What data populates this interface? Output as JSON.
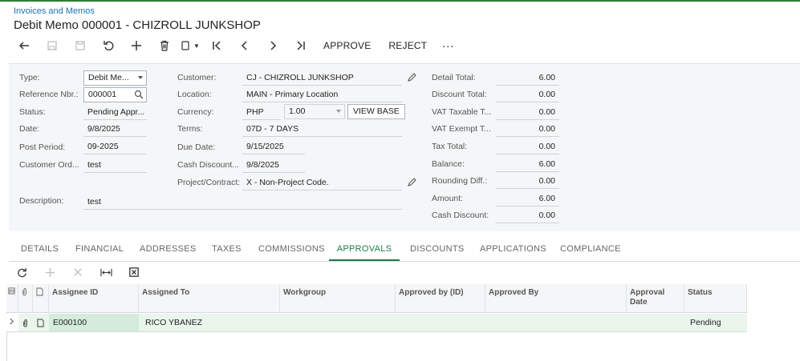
{
  "breadcrumb": "Invoices and Memos",
  "title": "Debit Memo 000001 - CHIZROLL JUNKSHOP",
  "toolbar": {
    "approve": "APPROVE",
    "reject": "REJECT",
    "more": "···"
  },
  "form": {
    "type_label": "Type:",
    "type_value": "Debit Me...",
    "ref_label": "Reference Nbr.:",
    "ref_value": "000001",
    "status_label": "Status:",
    "status_value": "Pending Appr...",
    "date_label": "Date:",
    "date_value": "9/8/2025",
    "period_label": "Post Period:",
    "period_value": "09-2025",
    "custord_label": "Customer Ord...",
    "custord_value": "test",
    "desc_label": "Description:",
    "desc_value": "test",
    "customer_label": "Customer:",
    "customer_value": "CJ - CHIZROLL JUNKSHOP",
    "location_label": "Location:",
    "location_value": "MAIN - Primary Location",
    "currency_label": "Currency:",
    "currency_value": "PHP",
    "rate_value": "1.00",
    "viewbase": "VIEW BASE",
    "terms_label": "Terms:",
    "terms_value": "07D - 7 DAYS",
    "due_label": "Due Date:",
    "due_value": "9/15/2025",
    "cashdisc_label": "Cash Discount...",
    "cashdisc_value": "9/8/2025",
    "project_label": "Project/Contract:",
    "project_value": "X - Non-Project Code."
  },
  "totals": [
    {
      "label": "Detail Total:",
      "value": "6.00"
    },
    {
      "label": "Discount Total:",
      "value": "0.00"
    },
    {
      "label": "VAT Taxable T...",
      "value": "0.00"
    },
    {
      "label": "VAT Exempt T...",
      "value": "0.00"
    },
    {
      "label": "Tax Total:",
      "value": "0.00"
    },
    {
      "label": "Balance:",
      "value": "6.00"
    },
    {
      "label": "Rounding Diff.:",
      "value": "0.00"
    },
    {
      "label": "Amount:",
      "value": "6.00"
    },
    {
      "label": "Cash Discount:",
      "value": "0.00"
    }
  ],
  "tabs": [
    "DETAILS",
    "FINANCIAL",
    "ADDRESSES",
    "TAXES",
    "COMMISSIONS",
    "APPROVALS",
    "DISCOUNTS",
    "APPLICATIONS",
    "COMPLIANCE"
  ],
  "active_tab": "APPROVALS",
  "grid": {
    "headers": [
      "Assignee ID",
      "Assigned To",
      "Workgroup",
      "Approved by (ID)",
      "Approved By",
      "Approval Date",
      "Status"
    ],
    "row": [
      "E000100",
      "RICO YBANEZ",
      "",
      "",
      "",
      "",
      "Pending"
    ]
  },
  "colors": {
    "accent": "#1e7a4c",
    "link": "#1f6fb2"
  }
}
